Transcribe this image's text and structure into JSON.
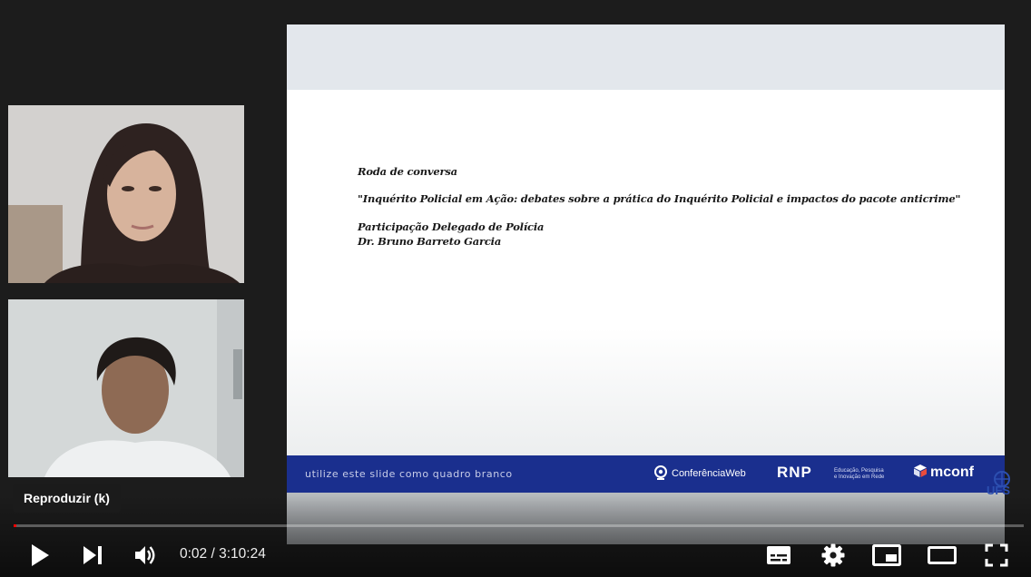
{
  "slide": {
    "line1": "Roda de conversa",
    "line2": "\"Inquérito Policial em Ação: debates sobre a prática do Inquérito Policial e impactos do pacote anticrime\"",
    "line3": "Participação Delegado de Polícia",
    "line4": "Dr. Bruno Barreto Garcia",
    "footer_text": "utilize este slide como quadro branco",
    "logos": {
      "conferencia": "ConferênciaWeb",
      "rnp": "RNP",
      "rnp_sub_1": "Educação, Pesquisa",
      "rnp_sub_2": "e Inovação em Rede",
      "mconf": "mconf"
    }
  },
  "watermark": "UFS",
  "tooltip": "Reproduzir (k)",
  "player": {
    "current_time": "0:02",
    "duration": "3:10:24",
    "time_separator": " / ",
    "progress": 0.0002,
    "accent_color": "#ff0000"
  },
  "icons": [
    "play-icon",
    "next-icon",
    "volume-icon",
    "subtitles-icon",
    "settings-icon",
    "miniplayer-icon",
    "theater-icon",
    "fullscreen-icon"
  ]
}
